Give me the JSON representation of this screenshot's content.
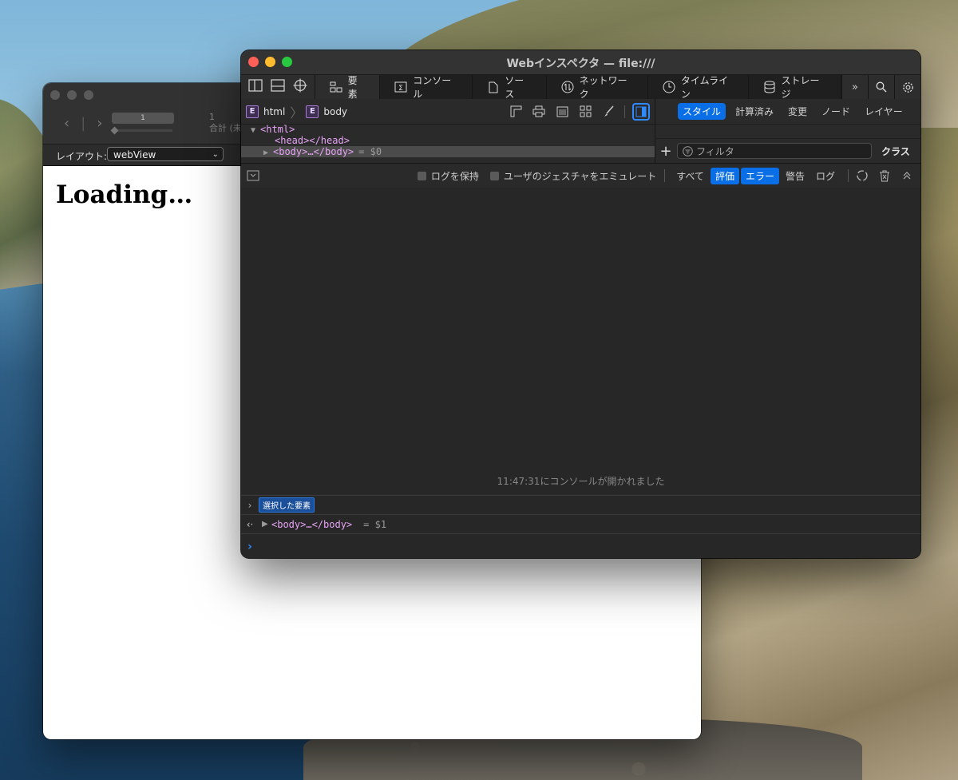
{
  "back_window": {
    "page_number": "1",
    "total_label": "合計 (未",
    "layout_label": "レイアウト:",
    "layout_value": "webView",
    "content_heading": "Loading…"
  },
  "inspector": {
    "title": "Webインスペクタ — file:///",
    "tabs": [
      {
        "label": "要素",
        "icon": "elements-icon"
      },
      {
        "label": "コンソール",
        "icon": "console-icon"
      },
      {
        "label": "ソース",
        "icon": "sources-icon"
      },
      {
        "label": "ネットワーク",
        "icon": "network-icon"
      },
      {
        "label": "タイムライン",
        "icon": "timeline-icon"
      },
      {
        "label": "ストレージ",
        "icon": "storage-icon"
      }
    ],
    "more_tabs": "»",
    "breadcrumb": [
      {
        "badge": "E",
        "label": "html"
      },
      {
        "badge": "E",
        "label": "body"
      }
    ],
    "side_tabs": [
      "スタイル",
      "計算済み",
      "変更",
      "ノード",
      "レイヤー"
    ],
    "active_side_tab": "スタイル",
    "filter_placeholder": "フィルタ",
    "class_button": "クラス",
    "dom": {
      "html_open": "<html>",
      "head": "<head></head>",
      "body": "<body>…</body>",
      "body_ref": "= $0"
    },
    "console_toolbar": {
      "preserve_log": "ログを保持",
      "emulate_gesture": "ユーザのジェスチャをエミュレート",
      "levels": [
        {
          "label": "すべて",
          "active": false
        },
        {
          "label": "評価",
          "active": true
        },
        {
          "label": "エラー",
          "active": true
        },
        {
          "label": "警告",
          "active": false
        },
        {
          "label": "ログ",
          "active": false
        }
      ]
    },
    "console_opened_message": "11:47:31にコンソールが開かれました",
    "selected_element_badge": "選択した要素",
    "result_line": "<body>…</body>",
    "result_ref": "= $1"
  },
  "colors": {
    "accent": "#0a6ee6",
    "tag": "#e6a3f5",
    "prompt": "#2d8bff"
  }
}
